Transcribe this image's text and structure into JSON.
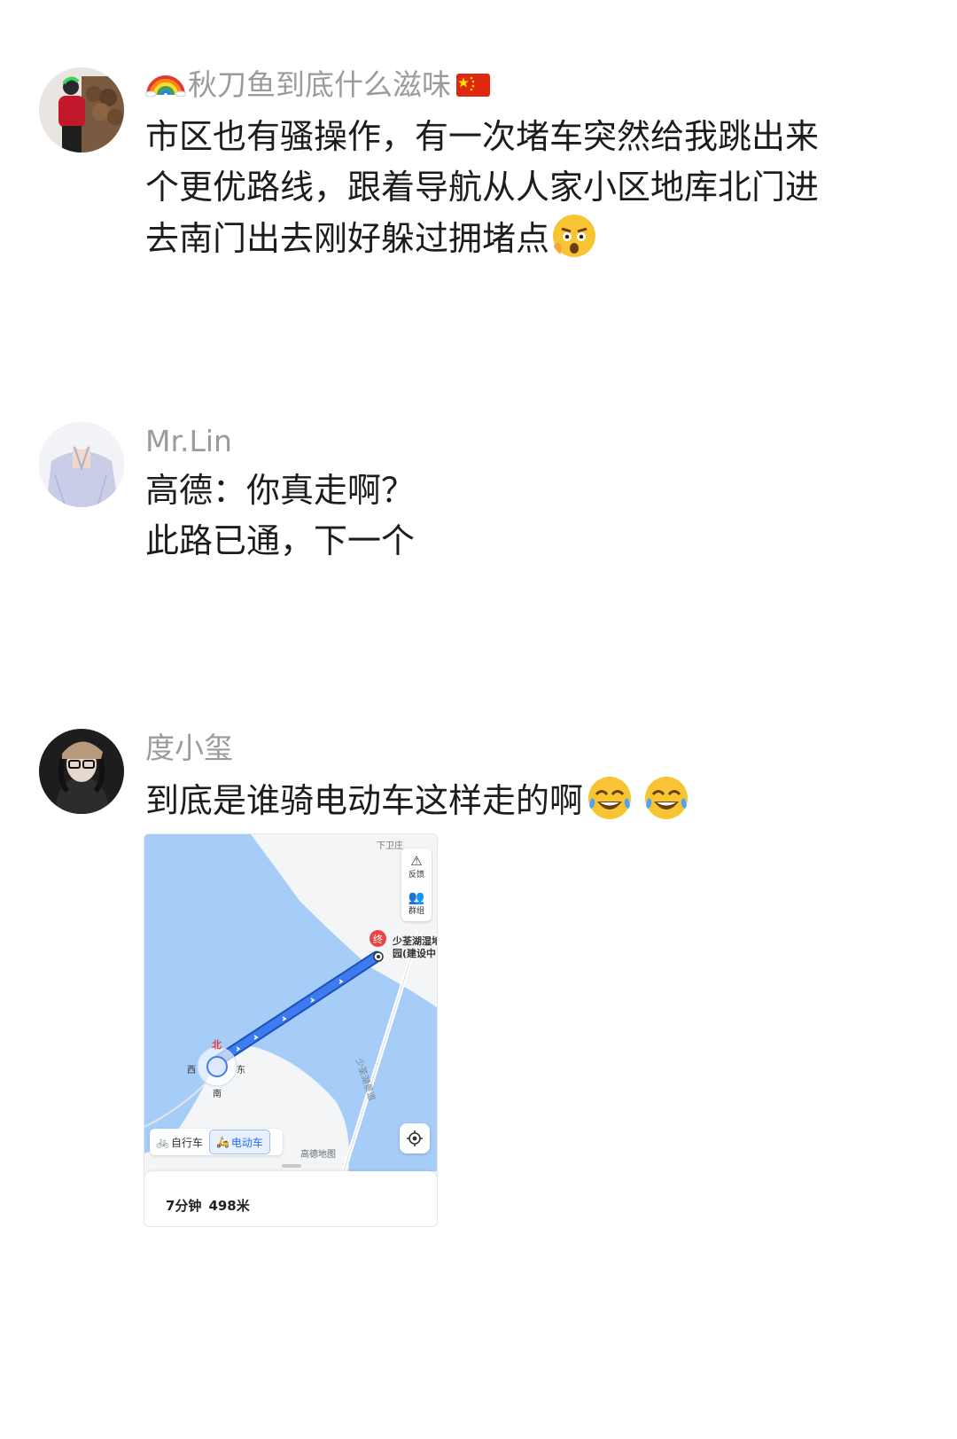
{
  "comments": [
    {
      "username": "秋刀鱼到底什么滋味",
      "lines": [
        "市区也有骚操作，有一次堵车突然给我跳出来",
        "个更优路线，跟着导航从人家小区地库北门进",
        "去南门出去刚好躲过拥堵点"
      ]
    },
    {
      "username": "Mr.Lin",
      "lines": [
        "高德：你真走啊？",
        "此路已通，下一个"
      ]
    },
    {
      "username": "度小玺",
      "lines": [
        "到底是谁骑电动车这样走的啊"
      ]
    }
  ],
  "map": {
    "top_place": "下卫庄",
    "feedback_label": "反馈",
    "group_label": "群组",
    "destination_marker": "终",
    "destination_line1": "少荃湖湿地",
    "destination_line2": "园(建设中",
    "road_label": "少荃湖景道",
    "compass": {
      "north": "北",
      "south": "南",
      "east": "东",
      "west": "西"
    },
    "tabs": {
      "bike": "自行车",
      "ebike": "电动车"
    },
    "watermark": "高德地图",
    "duration": "7分钟",
    "distance": "498米",
    "colors": {
      "water": "#a6cdf8",
      "route": "#2f6fe0",
      "land": "#f3f5f7"
    }
  }
}
